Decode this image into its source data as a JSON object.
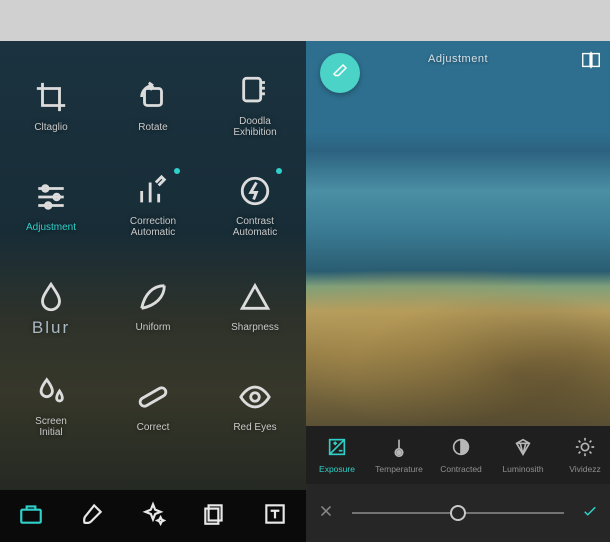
{
  "colors": {
    "accent": "#2fd0c9"
  },
  "header": {
    "title": "Adjustment"
  },
  "toolGrid": [
    {
      "id": "crop",
      "label": "Cltaglio"
    },
    {
      "id": "rotate",
      "label": "Rotate"
    },
    {
      "id": "doodle",
      "label": "Doodla\nExhibition"
    },
    {
      "id": "adjustment",
      "label": "Adjustment",
      "active": true,
      "dot": false
    },
    {
      "id": "autocolor",
      "label": "Correction\nAutomatic",
      "dot": true
    },
    {
      "id": "autocontrast",
      "label": "Contrast\nAutomatic",
      "dot": true
    },
    {
      "id": "blur",
      "label": "Blur"
    },
    {
      "id": "smooth",
      "label": "Uniform"
    },
    {
      "id": "sharpen",
      "label": "Sharpness"
    },
    {
      "id": "screen",
      "label": "Screen\nInitial"
    },
    {
      "id": "correct",
      "label": "Correct"
    },
    {
      "id": "redeye",
      "label": "Red Eyes"
    }
  ],
  "bottomNav": [
    {
      "id": "toolbox",
      "active": true
    },
    {
      "id": "brush"
    },
    {
      "id": "effects"
    },
    {
      "id": "layers"
    },
    {
      "id": "text"
    }
  ],
  "adjustStrip": [
    {
      "id": "exposure",
      "label": "Exposure",
      "active": true
    },
    {
      "id": "temperature",
      "label": "Temperature"
    },
    {
      "id": "contrast",
      "label": "Contracted"
    },
    {
      "id": "luminosity",
      "label": "Luminosith"
    },
    {
      "id": "vividness",
      "label": "Vividezz"
    }
  ],
  "slider": {
    "value": 50,
    "min": 0,
    "max": 100
  }
}
